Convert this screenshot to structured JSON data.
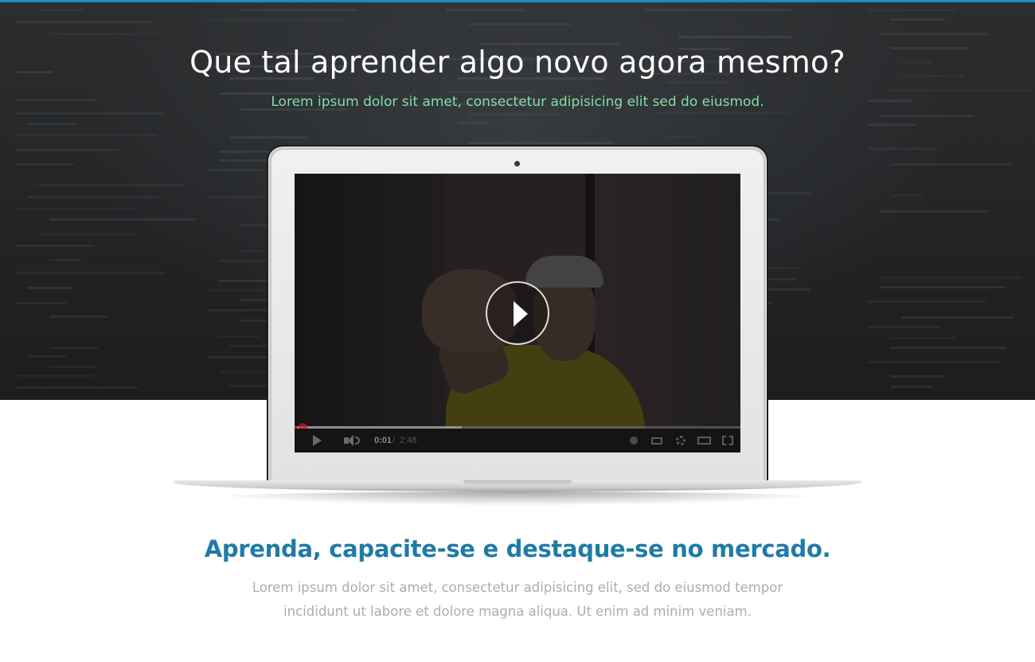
{
  "hero": {
    "title": "Que tal aprender algo novo agora mesmo?",
    "subtitle": "Lorem ipsum dolor sit amet, consectetur adipisicing elit sed do eiusmod."
  },
  "video": {
    "current_time": "0:01",
    "separator": "/",
    "duration": "2:48",
    "progress_fraction": 0.006,
    "buffered_fraction": 0.375
  },
  "section": {
    "title": "Aprenda, capacite-se e destaque-se no mercado.",
    "text": "Lorem ipsum dolor sit amet, consectetur adipisicing elit, sed do eiusmod tempor incididunt ut labore et dolore magna aliqua. Ut enim ad minim veniam."
  },
  "colors": {
    "accent_bar": "#1b8fb5",
    "subtitle": "#7fe0a4",
    "section_title": "#1f7ba6",
    "body_text": "#a7aeb6",
    "progress_played": "#cc181e"
  },
  "icons": [
    "play-icon",
    "volume-icon",
    "annotations-icon",
    "captions-icon",
    "settings-icon",
    "theater-icon",
    "fullscreen-icon",
    "camera-dot"
  ]
}
